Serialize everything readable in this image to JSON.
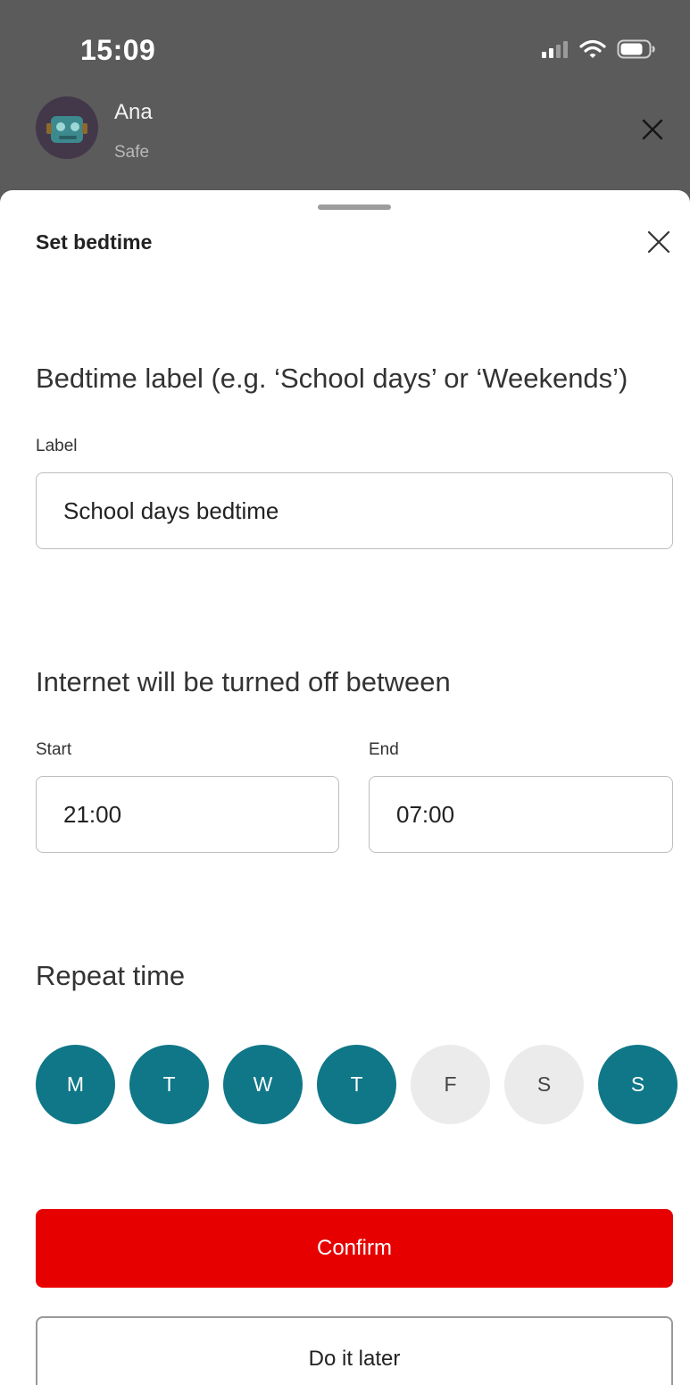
{
  "status_bar": {
    "time": "15:09",
    "icons": [
      "signal-icon",
      "wifi-icon",
      "battery-icon"
    ]
  },
  "profile": {
    "name": "Ana",
    "status": "Safe",
    "avatar_icon": "robot-avatar-icon"
  },
  "sheet": {
    "title": "Set bedtime",
    "label_section": {
      "heading": "Bedtime label (e.g. ‘School days’ or ‘Weekends’)",
      "field_label": "Label",
      "value": "School days bedtime"
    },
    "time_section": {
      "heading": "Internet will be turned off between",
      "start_label": "Start",
      "start_value": "21:00",
      "end_label": "End",
      "end_value": "07:00"
    },
    "repeat_section": {
      "heading": "Repeat time",
      "days": [
        {
          "letter": "M",
          "selected": true
        },
        {
          "letter": "T",
          "selected": true
        },
        {
          "letter": "W",
          "selected": true
        },
        {
          "letter": "T",
          "selected": true
        },
        {
          "letter": "F",
          "selected": false
        },
        {
          "letter": "S",
          "selected": false
        },
        {
          "letter": "S",
          "selected": true
        }
      ]
    },
    "confirm_label": "Confirm",
    "later_label": "Do it later"
  },
  "colors": {
    "accent_teal": "#0f7788",
    "confirm_red": "#e60000",
    "header_gray": "#5b5b5b",
    "day_off": "#ebebeb"
  }
}
